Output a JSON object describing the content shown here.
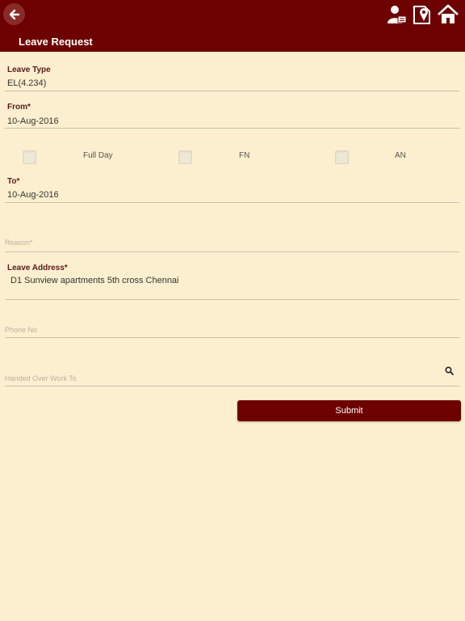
{
  "header": {
    "title": "Leave Request",
    "icons": [
      "back-arrow-icon",
      "user-card-icon",
      "map-location-icon",
      "home-icon"
    ]
  },
  "form": {
    "leave_type": {
      "label": "Leave Type",
      "value": "EL(4.234)"
    },
    "from": {
      "label": "From*",
      "value": "10-Aug-2016"
    },
    "options": [
      {
        "label": "Full Day",
        "checked": false
      },
      {
        "label": "FN",
        "checked": false
      },
      {
        "label": "AN",
        "checked": false
      }
    ],
    "to": {
      "label": "To*",
      "value": "10-Aug-2016"
    },
    "reason": {
      "placeholder": "Reason*"
    },
    "leave_address": {
      "label": "Leave Address*",
      "value": "D1 Sunview apartments 5th cross Chennai"
    },
    "phone": {
      "placeholder": "Phone No"
    },
    "handed_over": {
      "placeholder": "Handed Over Work To"
    },
    "submit_label": "Submit"
  },
  "colors": {
    "header": "#6d0000",
    "background": "#fcefd0",
    "label": "#5a1a1a"
  }
}
